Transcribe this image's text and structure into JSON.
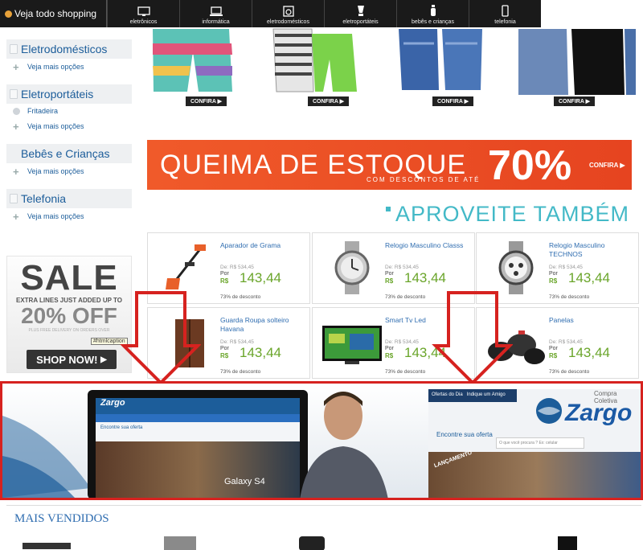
{
  "nav": {
    "shop_all": "Veja todo shopping",
    "categories": [
      {
        "label": "eletrônicos",
        "icon": "monitor-icon"
      },
      {
        "label": "informática",
        "icon": "laptop-icon"
      },
      {
        "label": "eletrodomésticos",
        "icon": "washer-icon"
      },
      {
        "label": "eletroportáteis",
        "icon": "blender-icon"
      },
      {
        "label": "bebês e crianças",
        "icon": "baby-bottle-icon"
      },
      {
        "label": "telefonia",
        "icon": "phone-icon"
      }
    ]
  },
  "sidebar": {
    "sections": [
      {
        "title": "Eletrodomésticos",
        "items": [
          "Veja mais opções"
        ]
      },
      {
        "title": "Eletroportáteis",
        "items": [
          "Fritadeira",
          "Veja mais opções"
        ]
      },
      {
        "title": "Bebês e Crianças",
        "items": [
          "Veja mais opções"
        ]
      },
      {
        "title": "Telefonia",
        "items": [
          "Veja mais opções"
        ]
      }
    ]
  },
  "sale_ad": {
    "title": "SALE",
    "line1": "EXTRA LINES JUST ADDED UP TO",
    "discount": "20% OFF",
    "line2": "PLUS FREE DELIVERY ON ORDERS OVER",
    "cta": "SHOP NOW!",
    "tooltip": "#htmlcaption"
  },
  "confira_label": "CONFIRA",
  "queima": {
    "title": "QUEIMA DE ESTOQUE",
    "sub": "COM DESCONTOS DE ATÉ",
    "pct": "70%",
    "cta": "CONFIRA"
  },
  "aproveite": "APROVEITE TAMBÉM",
  "products": [
    {
      "name": "Aparador de Grama",
      "old": "De: R$ 534,45",
      "por": "Por",
      "currency": "R$",
      "price": "143,44",
      "off": "73% de desconto"
    },
    {
      "name": "Relogio Masculino Classs",
      "old": "De: R$ 534,45",
      "por": "Por",
      "currency": "R$",
      "price": "143,44",
      "off": "73% de desconto"
    },
    {
      "name": "Relogio Masculino TECHNOS",
      "old": "De: R$ 534,45",
      "por": "Por",
      "currency": "R$",
      "price": "143,44",
      "off": "73% de desconto"
    },
    {
      "name": "Guarda Roupa solteiro Havana",
      "old": "De: R$ 534,45",
      "por": "Por",
      "currency": "R$",
      "price": "143,44",
      "off": "73% de desconto"
    },
    {
      "name": "Smart Tv Led",
      "old": "De: R$ 534,45",
      "por": "Por",
      "currency": "R$",
      "price": "143,44",
      "off": "73% de desconto"
    },
    {
      "name": "Panelas",
      "old": "De: R$ 534,45",
      "por": "Por",
      "currency": "R$",
      "price": "143,44",
      "off": "73% de desconto"
    }
  ],
  "zargo": {
    "logo": "Zargo",
    "sub": "Compra Coletiva",
    "search_label": "Encontre sua oferta",
    "search_placeholder": "O que você procura ? Ex: celular",
    "tab": "Ofertas do Dia",
    "tab2": "Indique um Amigo",
    "lancamento": "LANÇAMENTO",
    "phone": "Galaxy S4"
  },
  "mais_vendidos": "MAIS VENDIDOS",
  "colors": {
    "accent": "#1c5d9a",
    "price": "#6aa52a",
    "banner": "#e64420",
    "annotation": "#d6221f"
  }
}
